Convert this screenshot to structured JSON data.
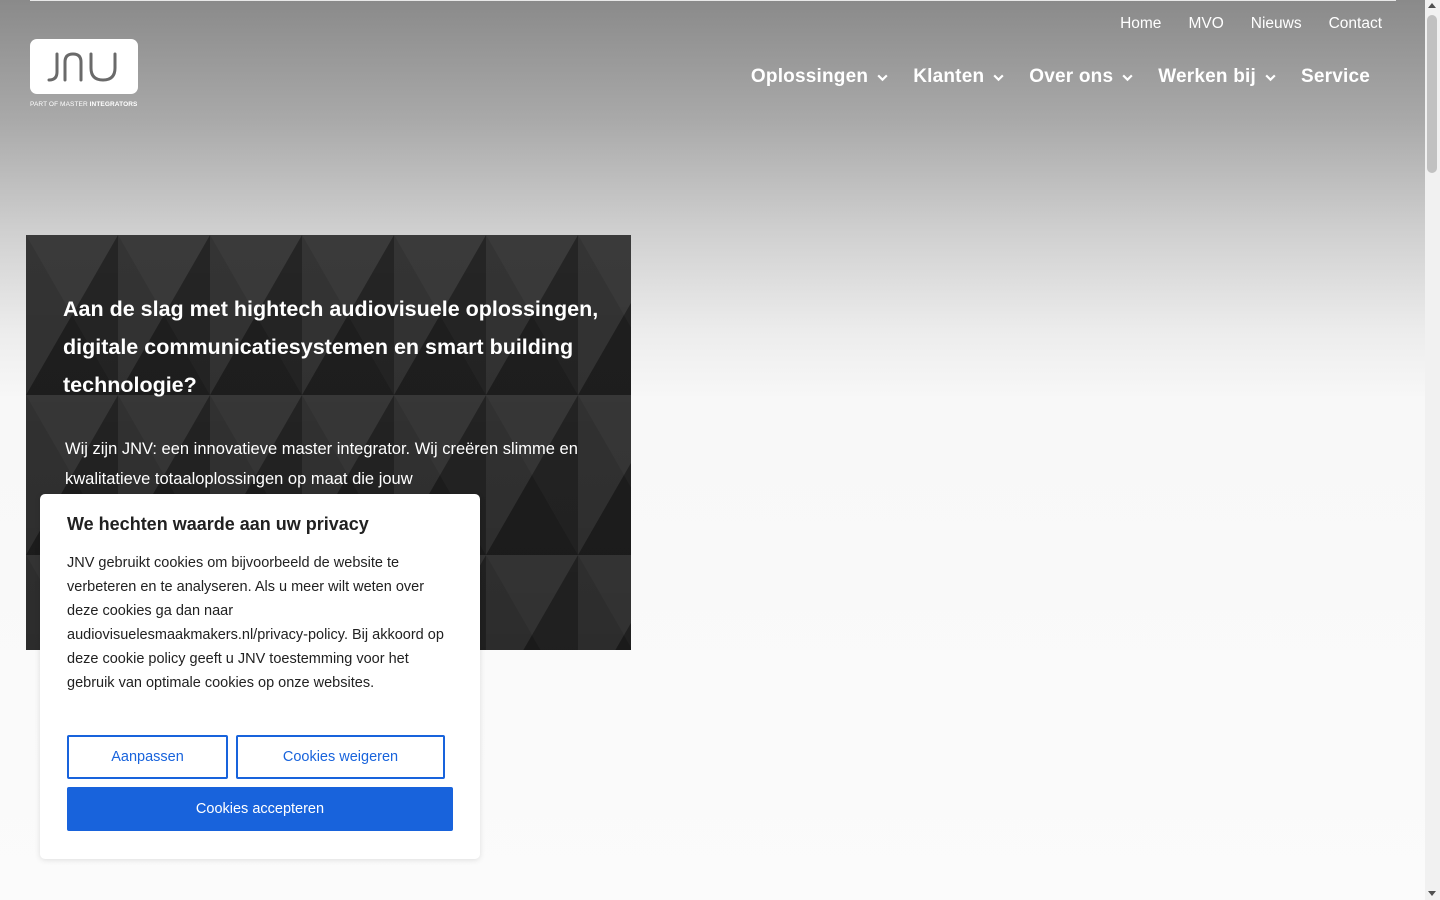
{
  "logo": {
    "mark": "JNV",
    "tagline_prefix": "PART OF MASTER ",
    "tagline_strong": "INTEGRATORS"
  },
  "top_links": [
    "Home",
    "MVO",
    "Nieuws",
    "Contact"
  ],
  "main_nav": [
    {
      "label": "Oplossingen",
      "dropdown": true
    },
    {
      "label": "Klanten",
      "dropdown": true
    },
    {
      "label": "Over ons",
      "dropdown": true
    },
    {
      "label": "Werken bij",
      "dropdown": true
    },
    {
      "label": "Service",
      "dropdown": false
    }
  ],
  "hero": {
    "title": "Aan de slag met hightech audiovisuele oplossingen, digitale communicatiesystemen en smart building technologie?",
    "text": "Wij zijn JNV: een innovatieve master integrator. Wij creëren slimme en kwalitatieve totaaloplossingen op maat die jouw"
  },
  "cookie": {
    "title": "We hechten waarde aan uw privacy",
    "text": "JNV gebruikt cookies om bijvoorbeeld de website te verbeteren en te analyseren. Als u meer wilt weten over deze cookies ga dan naar audiovisuelesmaakmakers.nl/privacy-policy. Bij akkoord op deze cookie policy geeft u JNV toestemming voor het gebruik van optimale cookies op onze websites.",
    "customize_label": "Aanpassen",
    "reject_label": "Cookies weigeren",
    "accept_label": "Cookies accepteren"
  },
  "colors": {
    "accent": "#1863dc",
    "hero_bg": "#2a2a2a",
    "text_dark": "#212121"
  },
  "icons": {
    "nav_dropdown": "chevron-down-icon"
  }
}
